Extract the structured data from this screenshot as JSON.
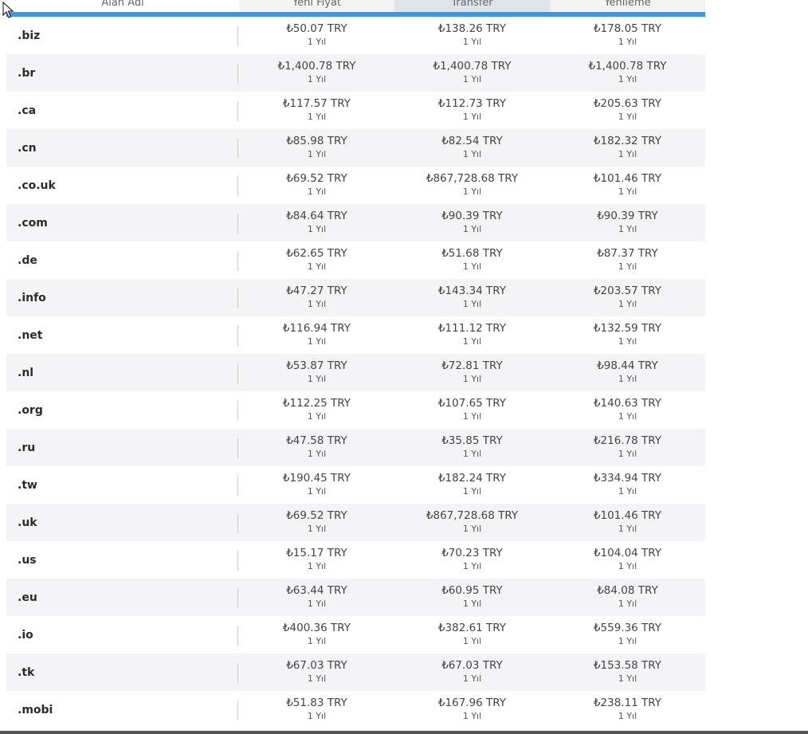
{
  "table": {
    "headers": [
      "Alan Adı",
      "Yeni Fiyat",
      "Transfer",
      "Yenileme"
    ],
    "period_label": "1 Yıl",
    "rows": [
      {
        "tld": ".biz",
        "register": "₺50.07 TRY",
        "transfer": "₺138.26 TRY",
        "renew": "₺178.05 TRY"
      },
      {
        "tld": ".br",
        "register": "₺1,400.78 TRY",
        "transfer": "₺1,400.78 TRY",
        "renew": "₺1,400.78 TRY"
      },
      {
        "tld": ".ca",
        "register": "₺117.57 TRY",
        "transfer": "₺112.73 TRY",
        "renew": "₺205.63 TRY"
      },
      {
        "tld": ".cn",
        "register": "₺85.98 TRY",
        "transfer": "₺82.54 TRY",
        "renew": "₺182.32 TRY"
      },
      {
        "tld": ".co.uk",
        "register": "₺69.52 TRY",
        "transfer": "₺867,728.68 TRY",
        "renew": "₺101.46 TRY"
      },
      {
        "tld": ".com",
        "register": "₺84.64 TRY",
        "transfer": "₺90.39 TRY",
        "renew": "₺90.39 TRY"
      },
      {
        "tld": ".de",
        "register": "₺62.65 TRY",
        "transfer": "₺51.68 TRY",
        "renew": "₺87.37 TRY"
      },
      {
        "tld": ".info",
        "register": "₺47.27 TRY",
        "transfer": "₺143.34 TRY",
        "renew": "₺203.57 TRY"
      },
      {
        "tld": ".net",
        "register": "₺116.94 TRY",
        "transfer": "₺111.12 TRY",
        "renew": "₺132.59 TRY"
      },
      {
        "tld": ".nl",
        "register": "₺53.87 TRY",
        "transfer": "₺72.81 TRY",
        "renew": "₺98.44 TRY"
      },
      {
        "tld": ".org",
        "register": "₺112.25 TRY",
        "transfer": "₺107.65 TRY",
        "renew": "₺140.63 TRY"
      },
      {
        "tld": ".ru",
        "register": "₺47.58 TRY",
        "transfer": "₺35.85 TRY",
        "renew": "₺216.78 TRY"
      },
      {
        "tld": ".tw",
        "register": "₺190.45 TRY",
        "transfer": "₺182.24 TRY",
        "renew": "₺334.94 TRY"
      },
      {
        "tld": ".uk",
        "register": "₺69.52 TRY",
        "transfer": "₺867,728.68 TRY",
        "renew": "₺101.46 TRY"
      },
      {
        "tld": ".us",
        "register": "₺15.17 TRY",
        "transfer": "₺70.23 TRY",
        "renew": "₺104.04 TRY"
      },
      {
        "tld": ".eu",
        "register": "₺63.44 TRY",
        "transfer": "₺60.95 TRY",
        "renew": "₺84.08 TRY"
      },
      {
        "tld": ".io",
        "register": "₺400.36 TRY",
        "transfer": "₺382.61 TRY",
        "renew": "₺559.36 TRY"
      },
      {
        "tld": ".tk",
        "register": "₺67.03 TRY",
        "transfer": "₺67.03 TRY",
        "renew": "₺153.58 TRY"
      },
      {
        "tld": ".mobi",
        "register": "₺51.83 TRY",
        "transfer": "₺167.96 TRY",
        "renew": "₺238.11 TRY"
      }
    ]
  },
  "colors": {
    "accent": "#3f95ee",
    "active_tab": "#0a62c9",
    "row_alt": "#f4f4f6"
  },
  "icons": {
    "cursor": "mouse-pointer-icon"
  }
}
